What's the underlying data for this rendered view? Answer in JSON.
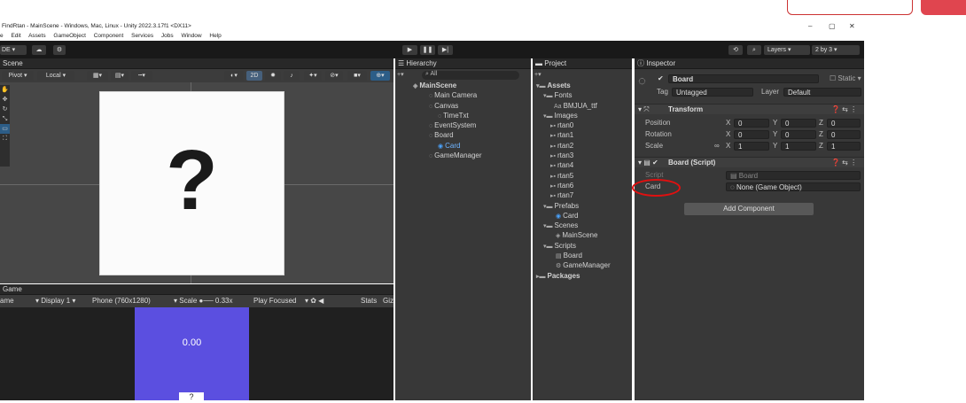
{
  "window": {
    "title": "FindRtan - MainScene - Windows, Mac, Linux - Unity 2022.3.17f1 <DX11>",
    "minimize": "–",
    "maximize": "▢",
    "close": "✕"
  },
  "menu": [
    "e",
    "Edit",
    "Assets",
    "GameObject",
    "Component",
    "Services",
    "Jobs",
    "Window",
    "Help"
  ],
  "toolbar": {
    "account": "DE ▾",
    "layers_label": "Layers",
    "layout_label": "2 by 3"
  },
  "scene": {
    "tab": "Scene",
    "pivot": "Pivot",
    "local": "Local",
    "mode_2d": "2D",
    "question_mark": "?"
  },
  "game": {
    "tab": "Game",
    "tab_prefix": "ame",
    "display": "Display 1",
    "resolution": "Phone (760x1280)",
    "scale_label": "Scale",
    "scale_value": "0.33x",
    "play_mode": "Play Focused",
    "stats": "Stats",
    "gizmos": "Giz",
    "score": "0.00",
    "card_text": "?"
  },
  "hierarchy": {
    "tab": "Hierarchy",
    "search_placeholder": "All",
    "items": [
      {
        "label": "MainScene",
        "depth": 0,
        "bold": true
      },
      {
        "label": "Main Camera",
        "depth": 1
      },
      {
        "label": "Canvas",
        "depth": 1
      },
      {
        "label": "TimeTxt",
        "depth": 2
      },
      {
        "label": "EventSystem",
        "depth": 1
      },
      {
        "label": "Board",
        "depth": 1
      },
      {
        "label": "Card",
        "depth": 2,
        "selected": true
      },
      {
        "label": "GameManager",
        "depth": 1
      }
    ]
  },
  "project": {
    "tab": "Project",
    "items": [
      {
        "label": "Assets",
        "depth": 0,
        "bold": true
      },
      {
        "label": "Fonts",
        "depth": 1
      },
      {
        "label": "BMJUA_ttf",
        "depth": 2
      },
      {
        "label": "Images",
        "depth": 1
      },
      {
        "label": "rtan0",
        "depth": 2
      },
      {
        "label": "rtan1",
        "depth": 2
      },
      {
        "label": "rtan2",
        "depth": 2
      },
      {
        "label": "rtan3",
        "depth": 2
      },
      {
        "label": "rtan4",
        "depth": 2
      },
      {
        "label": "rtan5",
        "depth": 2
      },
      {
        "label": "rtan6",
        "depth": 2
      },
      {
        "label": "rtan7",
        "depth": 2
      },
      {
        "label": "Prefabs",
        "depth": 1
      },
      {
        "label": "Card",
        "depth": 2
      },
      {
        "label": "Scenes",
        "depth": 1
      },
      {
        "label": "MainScene",
        "depth": 2
      },
      {
        "label": "Scripts",
        "depth": 1
      },
      {
        "label": "Board",
        "depth": 2
      },
      {
        "label": "GameManager",
        "depth": 2
      },
      {
        "label": "Packages",
        "depth": 0,
        "bold": true
      }
    ]
  },
  "inspector": {
    "tab": "Inspector",
    "object_name": "Board",
    "static_label": "Static",
    "tag_label": "Tag",
    "tag_value": "Untagged",
    "layer_label": "Layer",
    "layer_value": "Default",
    "transform": {
      "title": "Transform",
      "rows": [
        {
          "label": "Position",
          "x": "0",
          "y": "0",
          "z": "0"
        },
        {
          "label": "Rotation",
          "x": "0",
          "y": "0",
          "z": "0"
        },
        {
          "label": "Scale",
          "x": "1",
          "y": "1",
          "z": "1"
        }
      ]
    },
    "script_comp": {
      "title": "Board (Script)",
      "script_label": "Script",
      "script_value": "Board",
      "card_label": "Card",
      "card_value": "None (Game Object)"
    },
    "add_component": "Add Component"
  },
  "colors": {
    "accent": "#5b4fe0",
    "selection": "#2c5d87",
    "annotation": "#e01010"
  }
}
